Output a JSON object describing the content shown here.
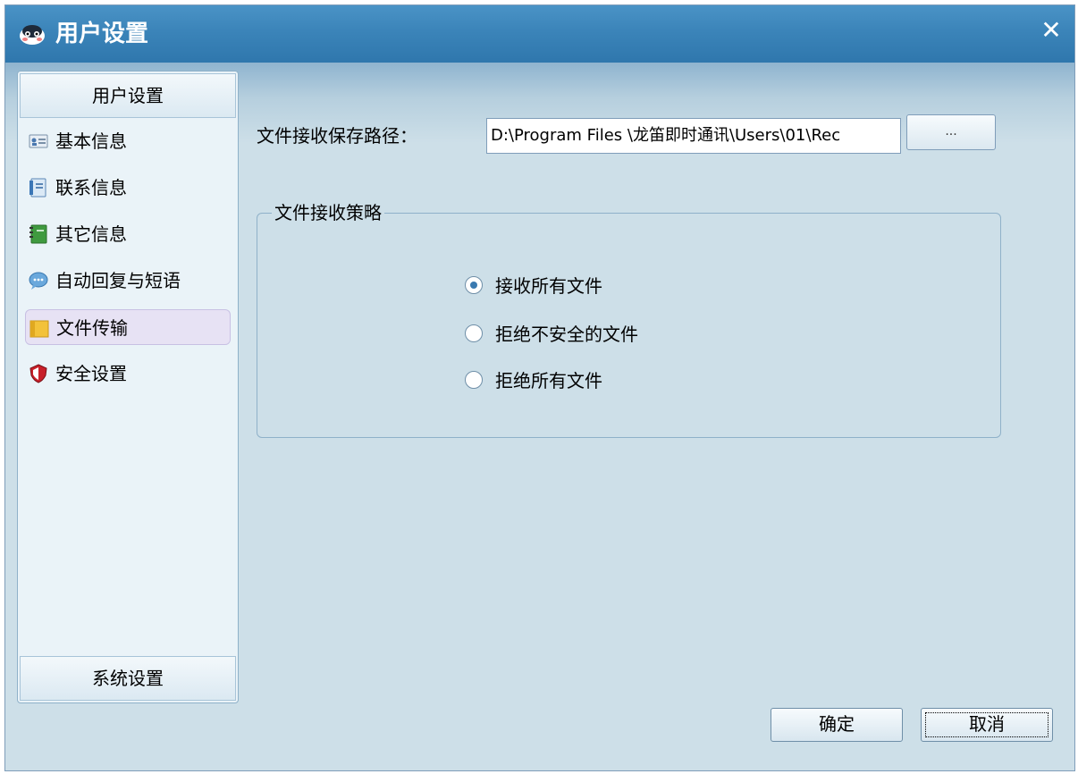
{
  "window": {
    "title": "用户设置",
    "close_symbol": "✕",
    "app_icon": "penguin-icon"
  },
  "sidebar": {
    "header": "用户设置",
    "footer": "系统设置",
    "items": [
      {
        "label": "基本信息",
        "icon": "id-card-icon"
      },
      {
        "label": "联系信息",
        "icon": "contact-card-icon"
      },
      {
        "label": "其它信息",
        "icon": "notebook-icon"
      },
      {
        "label": "自动回复与短语",
        "icon": "speech-bubble-icon"
      },
      {
        "label": "文件传输",
        "icon": "folder-icon",
        "selected": true
      },
      {
        "label": "安全设置",
        "icon": "shield-icon"
      }
    ]
  },
  "main": {
    "path_label": "文件接收保存路径：",
    "path_value": "D:\\Program Files \\龙笛即时通讯\\Users\\01\\Rec",
    "browse_label": "...",
    "policy_group": {
      "title": "文件接收策略",
      "options": [
        {
          "label": "接收所有文件",
          "selected": true
        },
        {
          "label": "拒绝不安全的文件",
          "selected": false
        },
        {
          "label": "拒绝所有文件",
          "selected": false
        }
      ]
    }
  },
  "footer": {
    "ok_label": "确定",
    "cancel_label": "取消"
  },
  "colors": {
    "titlebar": "#3b84b9",
    "window_bg": "#cddfe8",
    "sidebar_bg": "#eaf3f8",
    "selected_item_bg": "#e7e2f4",
    "radio_dot": "#3a7ab0"
  }
}
